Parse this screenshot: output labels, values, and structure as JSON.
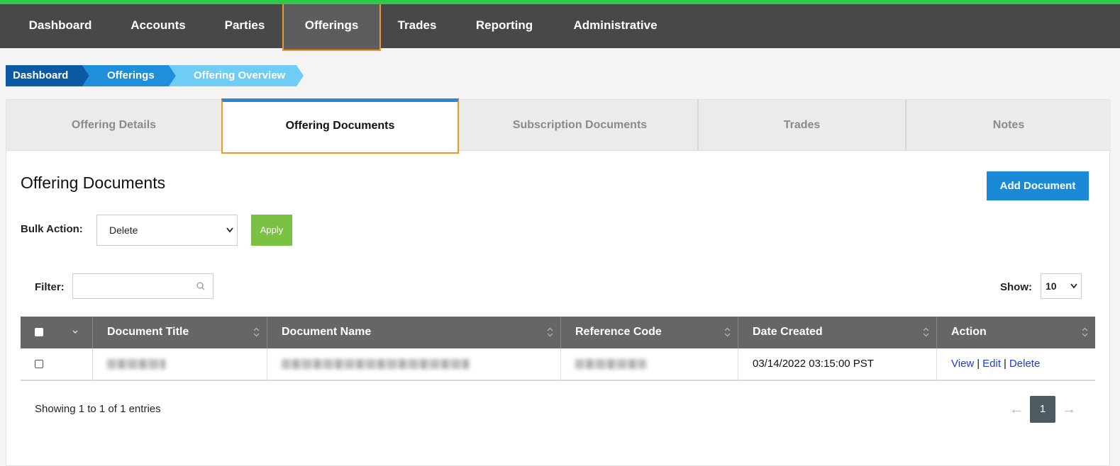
{
  "nav": {
    "items": [
      {
        "label": "Dashboard"
      },
      {
        "label": "Accounts"
      },
      {
        "label": "Parties"
      },
      {
        "label": "Offerings"
      },
      {
        "label": "Trades"
      },
      {
        "label": "Reporting"
      },
      {
        "label": "Administrative"
      }
    ],
    "active": "Offerings",
    "accent_color": "#2fc74c",
    "highlight_color": "#f0962a"
  },
  "breadcrumb": [
    {
      "label": "Dashboard",
      "color": "#0c5aa6"
    },
    {
      "label": "Offerings",
      "color": "#1f8fd9"
    },
    {
      "label": "Offering Overview",
      "color": "#6fcdf5"
    }
  ],
  "tabs": [
    {
      "label": "Offering Details"
    },
    {
      "label": "Offering Documents"
    },
    {
      "label": "Subscription Documents"
    },
    {
      "label": "Trades"
    },
    {
      "label": "Notes"
    }
  ],
  "active_tab": "Offering Documents",
  "main": {
    "title": "Offering Documents",
    "add_button": "Add Document",
    "bulk_label": "Bulk Action:",
    "bulk_value": "Delete",
    "apply_button": "Apply",
    "filter_label": "Filter:",
    "filter_value": "",
    "show_label": "Show:",
    "show_value": "10"
  },
  "table": {
    "columns": [
      "Document Title",
      "Document Name",
      "Reference Code",
      "Date Created",
      "Action"
    ],
    "rows": [
      {
        "document_title": "[redacted]",
        "document_name": "[redacted]",
        "reference_code": "[redacted]",
        "date_created": "03/14/2022 03:15:00 PST",
        "actions": [
          "View",
          "Edit",
          "Delete"
        ]
      }
    ]
  },
  "footer": {
    "showing": "Showing 1 to 1 of 1 entries",
    "current_page": "1",
    "prev_icon": "arrow-left-icon",
    "next_icon": "arrow-right-icon"
  }
}
